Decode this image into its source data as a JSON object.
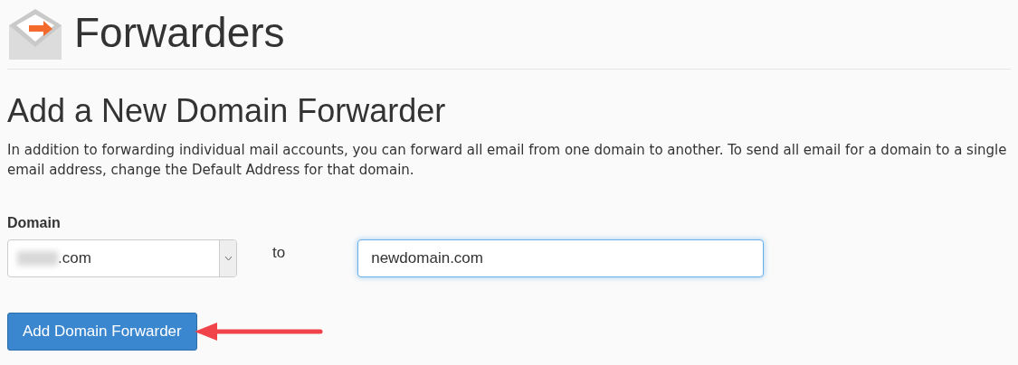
{
  "page_title": "Forwarders",
  "section": {
    "heading": "Add a New Domain Forwarder",
    "description": "In addition to forwarding individual mail accounts, you can forward all email from one domain to another. To send all email for a domain to a single email address, change the Default Address for that domain."
  },
  "form": {
    "domain_label": "Domain",
    "domain_value": ".com",
    "domain_redacted": true,
    "separator": "to",
    "target_value": "newdomain.com",
    "target_focused": true,
    "submit_label": "Add Domain Forwarder"
  },
  "annotation": {
    "kind": "arrow"
  }
}
